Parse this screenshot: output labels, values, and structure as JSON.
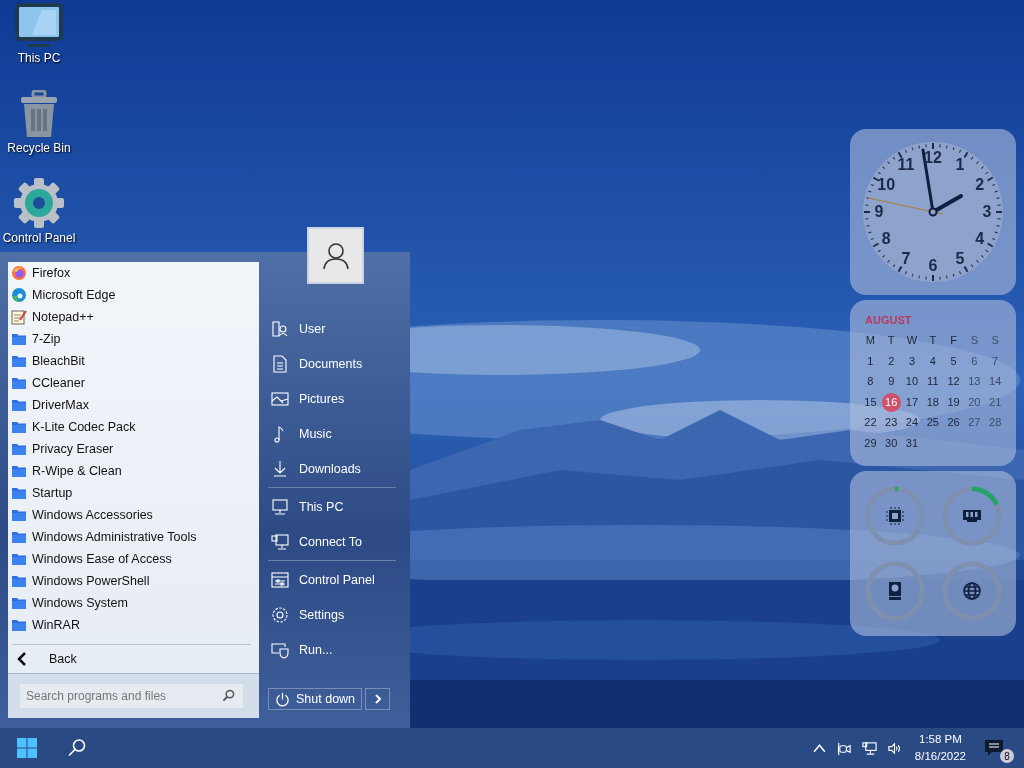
{
  "desktop_icons": [
    {
      "label": "This PC",
      "kind": "monitor"
    },
    {
      "label": "Recycle Bin",
      "kind": "bin"
    },
    {
      "label": "Control Panel",
      "kind": "gear"
    }
  ],
  "start_menu": {
    "programs": [
      {
        "label": "Firefox",
        "kind": "firefox"
      },
      {
        "label": "Microsoft Edge",
        "kind": "edge"
      },
      {
        "label": "Notepad++",
        "kind": "notepad"
      },
      {
        "label": "7-Zip",
        "kind": "folder"
      },
      {
        "label": "BleachBit",
        "kind": "folder"
      },
      {
        "label": "CCleaner",
        "kind": "folder"
      },
      {
        "label": "DriverMax",
        "kind": "folder"
      },
      {
        "label": "K-Lite Codec Pack",
        "kind": "folder"
      },
      {
        "label": "Privacy Eraser",
        "kind": "folder"
      },
      {
        "label": "R-Wipe & Clean",
        "kind": "folder"
      },
      {
        "label": "Startup",
        "kind": "folder"
      },
      {
        "label": "Windows Accessories",
        "kind": "folder"
      },
      {
        "label": "Windows Administrative Tools",
        "kind": "folder"
      },
      {
        "label": "Windows Ease of Access",
        "kind": "folder"
      },
      {
        "label": "Windows PowerShell",
        "kind": "folder"
      },
      {
        "label": "Windows System",
        "kind": "folder"
      },
      {
        "label": "WinRAR",
        "kind": "folder"
      }
    ],
    "back": "Back",
    "search": {
      "placeholder": "Search programs and files"
    },
    "place_groups": [
      [
        {
          "label": "User",
          "kind": "user"
        },
        {
          "label": "Documents",
          "kind": "document"
        },
        {
          "label": "Pictures",
          "kind": "picture"
        },
        {
          "label": "Music",
          "kind": "music"
        },
        {
          "label": "Downloads",
          "kind": "download"
        }
      ],
      [
        {
          "label": "This PC",
          "kind": "monitor"
        },
        {
          "label": "Connect To",
          "kind": "network"
        }
      ],
      [
        {
          "label": "Control Panel",
          "kind": "panel"
        },
        {
          "label": "Settings",
          "kind": "gear"
        },
        {
          "label": "Run...",
          "kind": "run"
        }
      ]
    ],
    "shutdown": "Shut down"
  },
  "clock": {
    "numbers": [
      "12",
      "11",
      "1",
      "10",
      "2",
      "9",
      "3",
      "8",
      "4",
      "7",
      "5",
      "6"
    ]
  },
  "calendar": {
    "month": "AUGUST",
    "weekdays": [
      "M",
      "T",
      "W",
      "T",
      "F",
      "S",
      "S"
    ],
    "weeks": [
      [
        {
          "day": "1",
          "selected": false
        },
        {
          "day": "2",
          "selected": false
        },
        {
          "day": "3",
          "selected": false
        },
        {
          "day": "4",
          "selected": false
        },
        {
          "day": "5",
          "selected": false
        },
        {
          "day": "6",
          "selected": false
        },
        {
          "day": "7",
          "selected": false
        }
      ],
      [
        {
          "day": "8",
          "selected": false
        },
        {
          "day": "9",
          "selected": false
        },
        {
          "day": "10",
          "selected": false
        },
        {
          "day": "11",
          "selected": false
        },
        {
          "day": "12",
          "selected": false
        },
        {
          "day": "13",
          "selected": false
        },
        {
          "day": "14",
          "selected": false
        }
      ],
      [
        {
          "day": "15",
          "selected": false
        },
        {
          "day": "16",
          "selected": true
        },
        {
          "day": "17",
          "selected": false
        },
        {
          "day": "18",
          "selected": false
        },
        {
          "day": "19",
          "selected": false
        },
        {
          "day": "20",
          "selected": false
        },
        {
          "day": "21",
          "selected": false
        }
      ],
      [
        {
          "day": "22",
          "selected": false
        },
        {
          "day": "23",
          "selected": false
        },
        {
          "day": "24",
          "selected": false
        },
        {
          "day": "25",
          "selected": false
        },
        {
          "day": "26",
          "selected": false
        },
        {
          "day": "27",
          "selected": false
        },
        {
          "day": "28",
          "selected": false
        }
      ],
      [
        {
          "day": "29",
          "selected": false
        },
        {
          "day": "30",
          "selected": false
        },
        {
          "day": "31",
          "selected": false
        }
      ]
    ]
  },
  "meters": [
    {
      "kind": "cpu"
    },
    {
      "kind": "memory"
    },
    {
      "kind": "disk"
    },
    {
      "kind": "network"
    }
  ],
  "taskbar": {
    "time": "1:58 PM",
    "date": "8/16/2022",
    "notifications": "8"
  }
}
